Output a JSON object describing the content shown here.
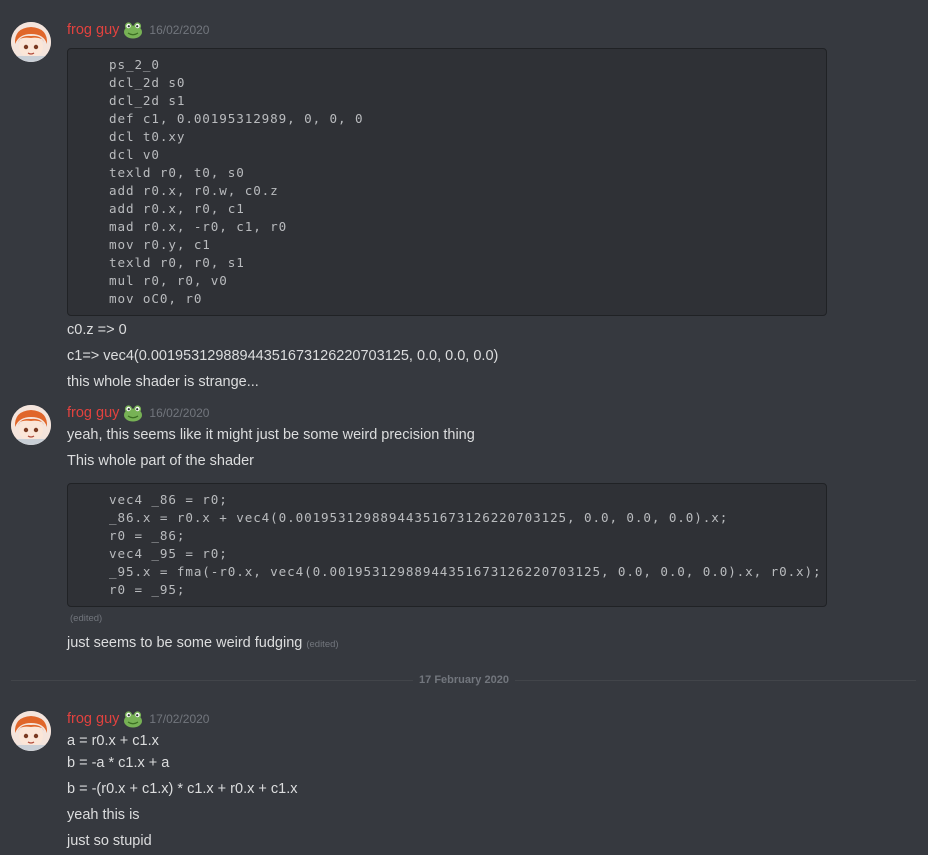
{
  "colors": {
    "background": "#36393f",
    "username": "#e2423f",
    "timestamp": "#72767d",
    "code_bg": "#2f3136"
  },
  "messages": [
    {
      "author": "frog guy",
      "author_icon": "frog-icon",
      "timestamp": "16/02/2020",
      "code": [
        "ps_2_0",
        "dcl_2d s0",
        "dcl_2d s1",
        "def c1, 0.00195312989, 0, 0, 0",
        "dcl t0.xy",
        "dcl v0",
        "texld r0, t0, s0",
        "add r0.x, r0.w, c0.z",
        "add r0.x, r0, c1",
        "mad r0.x, -r0, c1, r0",
        "mov r0.y, c1",
        "texld r0, r0, s1",
        "mul r0, r0, v0",
        "mov oC0, r0"
      ],
      "lines": [
        "c0.z => 0",
        "c1=> vec4(0.001953129889443516731262207031​25, 0.0, 0.0, 0.0)",
        "this whole shader is strange..."
      ]
    },
    {
      "author": "frog guy",
      "author_icon": "frog-icon",
      "timestamp": "16/02/2020",
      "lines": [
        "yeah, this seems like it might just be some weird precision thing",
        "This whole part of the shader"
      ],
      "code": [
        "vec4 _86 = r0;",
        "_86.x = r0.x + vec4(0.0019531298894435167312622070312​5, 0.0, 0.0, 0.0).x;",
        "r0 = _86;",
        "vec4 _95 = r0;",
        "_95.x = fma(-r0.x, vec4(0.0019531298894435167312622070312​5, 0.0, 0.0, 0.0).x, r0.x);",
        "r0 = _95;"
      ],
      "code_edited": "(edited)",
      "after_code": "just seems to be some weird fudging",
      "after_code_edited": "(edited)"
    },
    {
      "author": "frog guy",
      "author_icon": "frog-icon",
      "timestamp": "17/02/2020",
      "lines": [
        "a = r0.x + c1.x",
        "b = -a * c1.x + a",
        "b = -(r0.x + c1.x) * c1.x + r0.x + c1.x",
        "yeah this is",
        "just so stupid"
      ]
    }
  ],
  "divider": {
    "label": "17 February 2020"
  }
}
